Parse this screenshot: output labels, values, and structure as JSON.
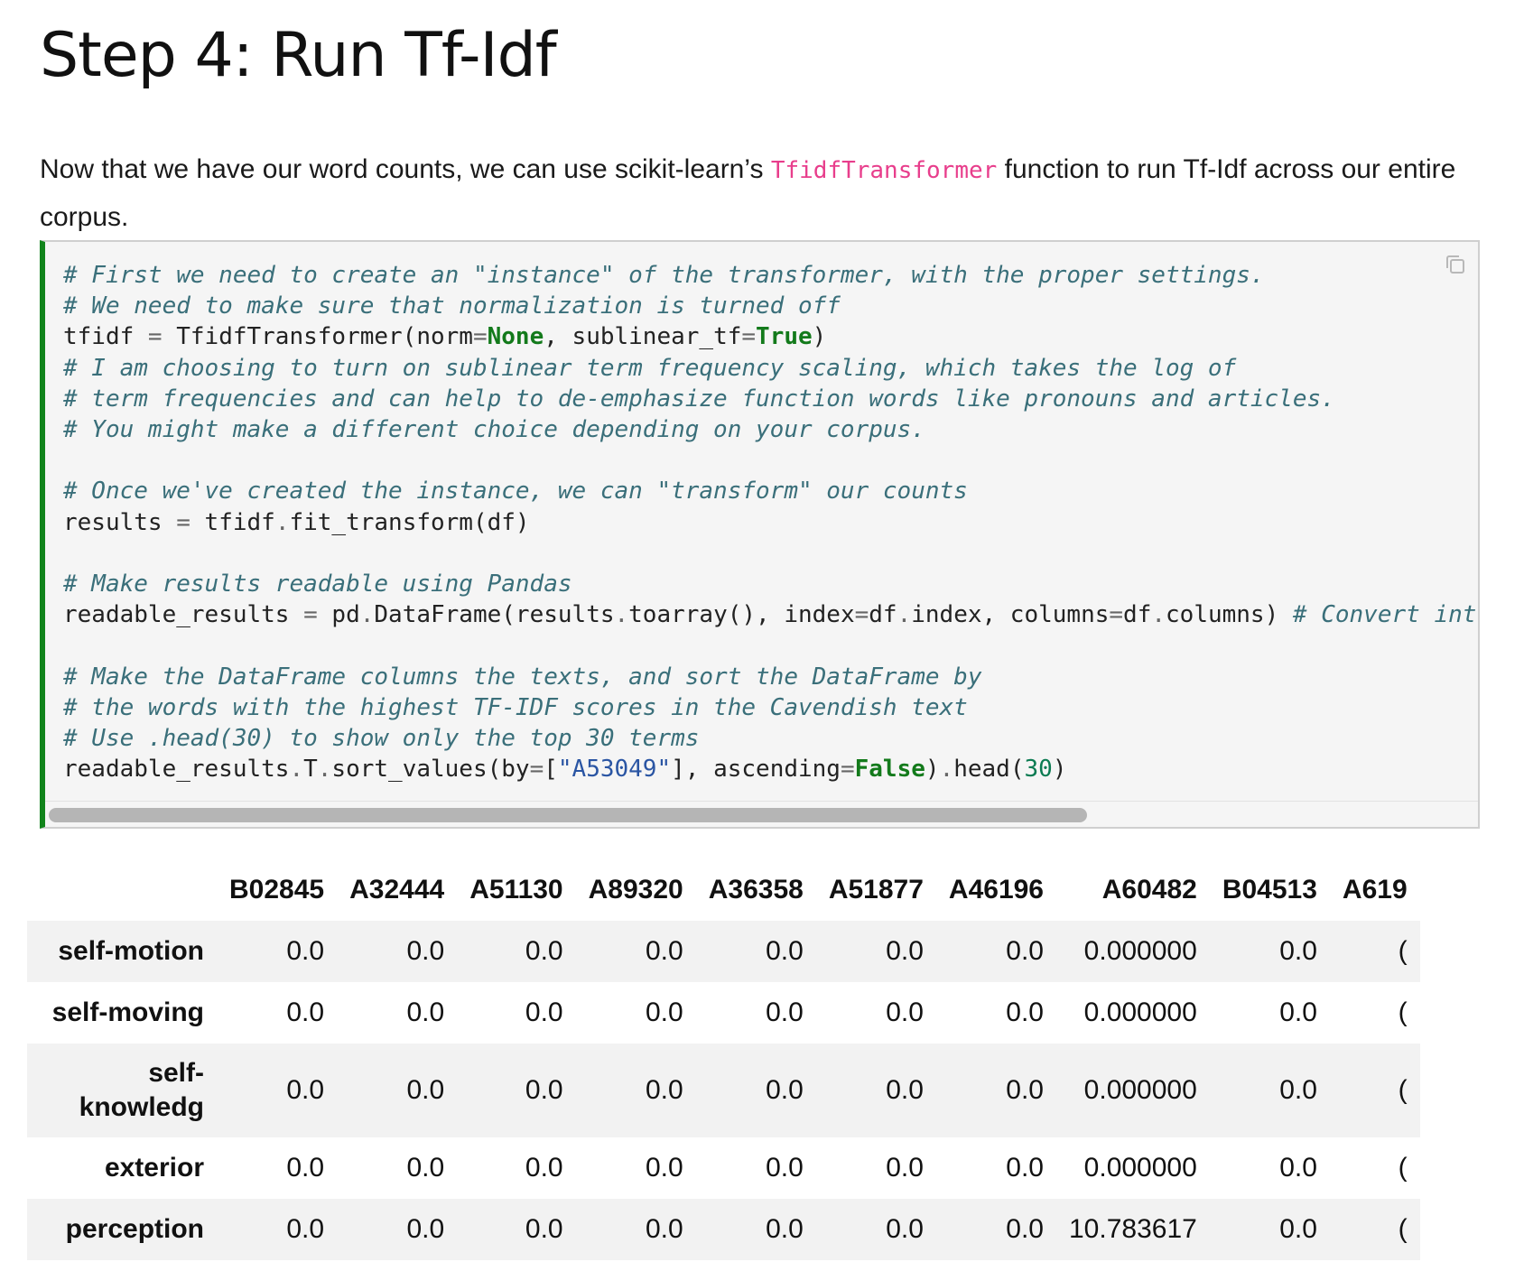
{
  "title": "Step 4: Run Tf-Idf",
  "intro": {
    "before": "Now that we have our word counts, we can use scikit-learn’s ",
    "code": "TfidfTransformer",
    "after": " function to run Tf-Idf across our entire corpus."
  },
  "code_lines": [
    [
      {
        "t": "# First we need to create an \"instance\" of the transformer, with the proper settings.",
        "c": "c"
      }
    ],
    [
      {
        "t": "# We need to make sure that normalization is turned off",
        "c": "c"
      }
    ],
    [
      {
        "t": "tfidf "
      },
      {
        "t": "=",
        "c": "o"
      },
      {
        "t": " TfidfTransformer(norm"
      },
      {
        "t": "=",
        "c": "o"
      },
      {
        "t": "None",
        "c": "k"
      },
      {
        "t": ", sublinear_tf"
      },
      {
        "t": "=",
        "c": "o"
      },
      {
        "t": "True",
        "c": "k"
      },
      {
        "t": ")"
      }
    ],
    [
      {
        "t": "# I am choosing to turn on sublinear term frequency scaling, which takes the log of",
        "c": "c"
      }
    ],
    [
      {
        "t": "# term frequencies and can help to de-emphasize function words like pronouns and articles.",
        "c": "c"
      }
    ],
    [
      {
        "t": "# You might make a different choice depending on your corpus.",
        "c": "c"
      }
    ],
    [
      {
        "t": ""
      }
    ],
    [
      {
        "t": "# Once we've created the instance, we can \"transform\" our counts",
        "c": "c"
      }
    ],
    [
      {
        "t": "results "
      },
      {
        "t": "=",
        "c": "o"
      },
      {
        "t": " tfidf"
      },
      {
        "t": ".",
        "c": "o"
      },
      {
        "t": "fit_transform(df)"
      }
    ],
    [
      {
        "t": ""
      }
    ],
    [
      {
        "t": "# Make results readable using Pandas",
        "c": "c"
      }
    ],
    [
      {
        "t": "readable_results "
      },
      {
        "t": "=",
        "c": "o"
      },
      {
        "t": " pd"
      },
      {
        "t": ".",
        "c": "o"
      },
      {
        "t": "DataFrame(results"
      },
      {
        "t": ".",
        "c": "o"
      },
      {
        "t": "toarray(), index"
      },
      {
        "t": "=",
        "c": "o"
      },
      {
        "t": "df"
      },
      {
        "t": ".",
        "c": "o"
      },
      {
        "t": "index, columns"
      },
      {
        "t": "=",
        "c": "o"
      },
      {
        "t": "df"
      },
      {
        "t": ".",
        "c": "o"
      },
      {
        "t": "columns) "
      },
      {
        "t": "# Convert int",
        "c": "c"
      }
    ],
    [
      {
        "t": ""
      }
    ],
    [
      {
        "t": "# Make the DataFrame columns the texts, and sort the DataFrame by",
        "c": "c"
      }
    ],
    [
      {
        "t": "# the words with the highest TF-IDF scores in the Cavendish text",
        "c": "c"
      }
    ],
    [
      {
        "t": "# Use .head(30) to show only the top 30 terms",
        "c": "c"
      }
    ],
    [
      {
        "t": "readable_results"
      },
      {
        "t": ".",
        "c": "o"
      },
      {
        "t": "T"
      },
      {
        "t": ".",
        "c": "o"
      },
      {
        "t": "sort_values(by"
      },
      {
        "t": "=",
        "c": "o"
      },
      {
        "t": "["
      },
      {
        "t": "\"A53049\"",
        "c": "s"
      },
      {
        "t": "], ascending"
      },
      {
        "t": "=",
        "c": "o"
      },
      {
        "t": "False",
        "c": "k"
      },
      {
        "t": ")"
      },
      {
        "t": ".",
        "c": "o"
      },
      {
        "t": "head("
      },
      {
        "t": "30",
        "c": "n"
      },
      {
        "t": ")"
      }
    ]
  ],
  "table": {
    "columns": [
      "B02845",
      "A32444",
      "A51130",
      "A89320",
      "A36358",
      "A51877",
      "A46196",
      "A60482",
      "B04513",
      "A619"
    ],
    "rows": [
      {
        "label": "self-motion",
        "values": [
          "0.0",
          "0.0",
          "0.0",
          "0.0",
          "0.0",
          "0.0",
          "0.0",
          "0.000000",
          "0.0",
          "("
        ]
      },
      {
        "label": "self-moving",
        "values": [
          "0.0",
          "0.0",
          "0.0",
          "0.0",
          "0.0",
          "0.0",
          "0.0",
          "0.000000",
          "0.0",
          "("
        ]
      },
      {
        "label": "self-knowledg",
        "values": [
          "0.0",
          "0.0",
          "0.0",
          "0.0",
          "0.0",
          "0.0",
          "0.0",
          "0.000000",
          "0.0",
          "("
        ]
      },
      {
        "label": "exterior",
        "values": [
          "0.0",
          "0.0",
          "0.0",
          "0.0",
          "0.0",
          "0.0",
          "0.0",
          "0.000000",
          "0.0",
          "("
        ]
      },
      {
        "label": "perception",
        "values": [
          "0.0",
          "0.0",
          "0.0",
          "0.0",
          "0.0",
          "0.0",
          "0.0",
          "10.783617",
          "0.0",
          "("
        ]
      }
    ]
  }
}
